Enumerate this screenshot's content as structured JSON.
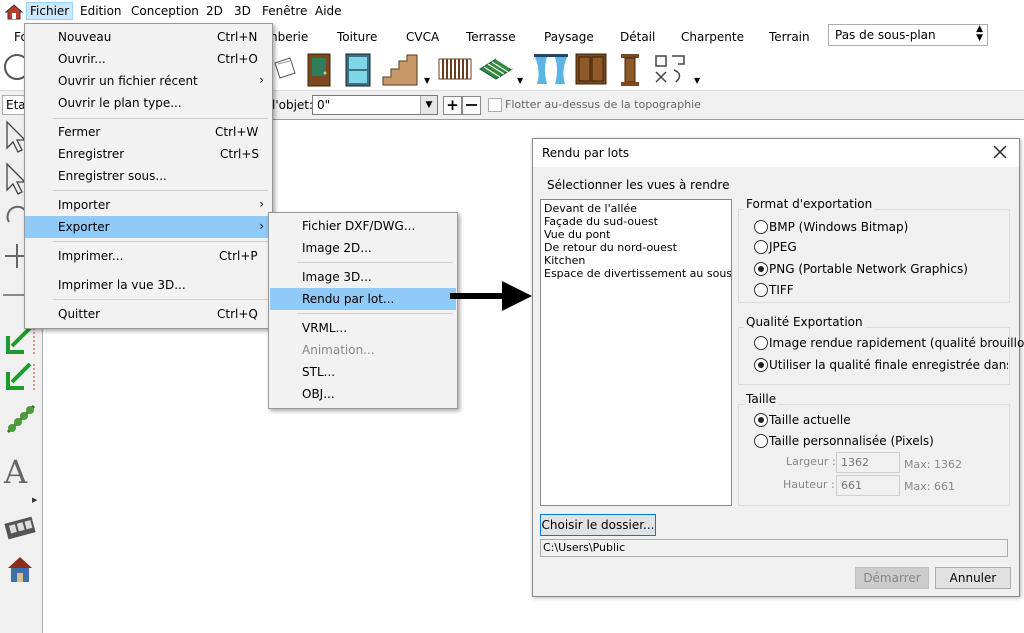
{
  "menubar": {
    "items": [
      "Fichier",
      "Edition",
      "Conception",
      "2D",
      "3D",
      "Fenêtre",
      "Aide"
    ]
  },
  "tabs": [
    "Fo",
    "nberie",
    "Toiture",
    "CVCA",
    "Terrasse",
    "Paysage",
    "Détail",
    "Charpente",
    "Terrain"
  ],
  "subplan_select": "Pas de sous-plan",
  "propbar": {
    "left_label": "Eta",
    "object_label": "l'objet:",
    "angle_value": "0\"",
    "float_label": "Flotter au-dessus de la topographie"
  },
  "file_menu": {
    "items": [
      {
        "label": "Nouveau",
        "shortcut": "Ctrl+N"
      },
      {
        "label": "Ouvrir...",
        "shortcut": "Ctrl+O"
      },
      {
        "label": "Ouvrir un fichier récent",
        "shortcut": "",
        "submenu": true
      },
      {
        "label": "Ouvrir le plan type...",
        "shortcut": ""
      },
      {
        "label": "Fermer",
        "shortcut": "Ctrl+W"
      },
      {
        "label": "Enregistrer",
        "shortcut": "Ctrl+S"
      },
      {
        "label": "Enregistrer sous...",
        "shortcut": ""
      },
      {
        "label": "Importer",
        "shortcut": "",
        "submenu": true
      },
      {
        "label": "Exporter",
        "shortcut": "",
        "submenu": true
      },
      {
        "label": "Imprimer...",
        "shortcut": "Ctrl+P"
      },
      {
        "label": "Imprimer la vue 3D...",
        "shortcut": ""
      },
      {
        "label": "Quitter",
        "shortcut": "Ctrl+Q"
      }
    ]
  },
  "export_menu": {
    "items": [
      {
        "label": "Fichier DXF/DWG..."
      },
      {
        "label": "Image 2D..."
      },
      {
        "label": "Image 3D..."
      },
      {
        "label": "Rendu par lot..."
      },
      {
        "label": "VRML..."
      },
      {
        "label": "Animation..."
      },
      {
        "label": "STL..."
      },
      {
        "label": "OBJ..."
      }
    ]
  },
  "dialog": {
    "title": "Rendu par lots",
    "views_label": "Sélectionner les vues à rendre",
    "views": [
      "Devant de l'allée",
      "Façade du sud-ouest",
      "Vue du pont",
      "De retour du nord-ouest",
      "Kitchen",
      "Espace de divertissement au sous-so"
    ],
    "format_group": "Format d'exportation",
    "formats": [
      "BMP (Windows Bitmap)",
      "JPEG",
      "PNG (Portable Network Graphics)",
      "TIFF"
    ],
    "format_selected": "PNG (Portable Network Graphics)",
    "quality_group": "Qualité Exportation",
    "qualities": [
      "Image rendue rapidement (qualité brouillon)",
      "Utiliser la qualité finale enregistrée dans les pa"
    ],
    "quality_selected": "Utiliser la qualité finale enregistrée dans les pa",
    "size_group": "Taille",
    "sizes": [
      "Taille actuelle",
      "Taille personnalisée (Pixels)"
    ],
    "size_selected": "Taille actuelle",
    "width_label": "Largeur :",
    "width_value": "1362",
    "width_max": "Max: 1362",
    "height_label": "Hauteur :",
    "height_value": "661",
    "height_max": "Max: 661",
    "choose_folder": "Choisir le dossier...",
    "folder_path": "C:\\Users\\Public",
    "start_button": "Démarrer",
    "cancel_button": "Annuler"
  }
}
